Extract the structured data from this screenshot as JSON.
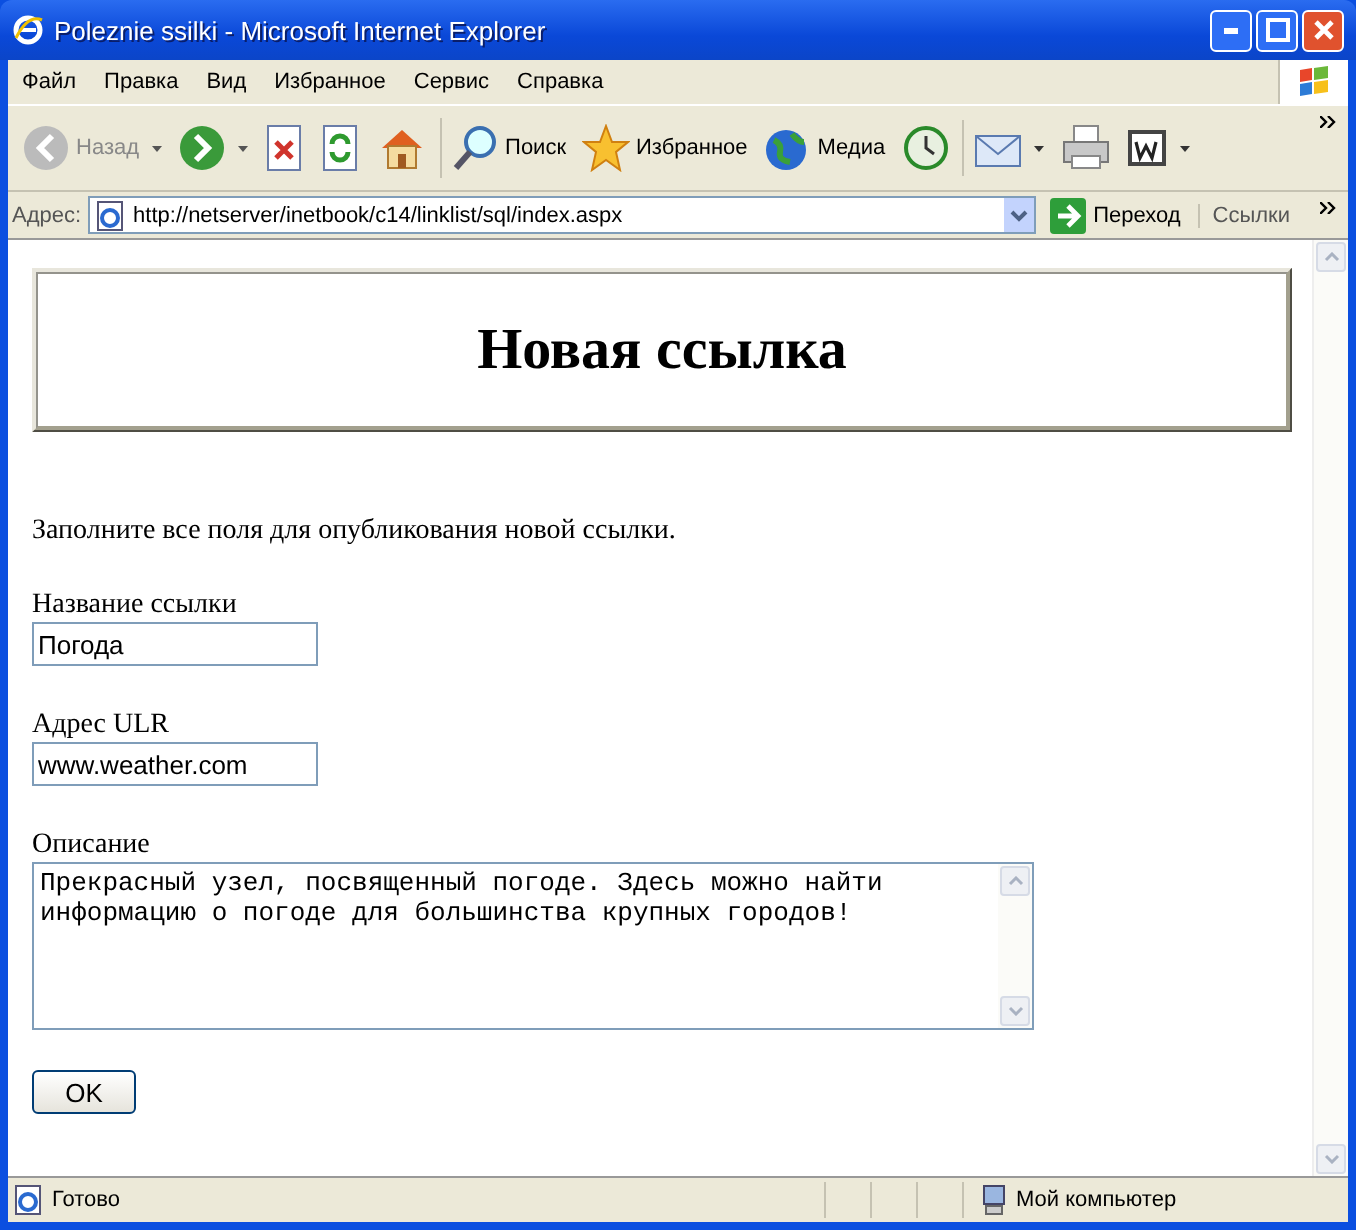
{
  "window": {
    "title": "Poleznie ssilki - Microsoft Internet Explorer"
  },
  "menu": [
    "Файл",
    "Правка",
    "Вид",
    "Избранное",
    "Сервис",
    "Справка"
  ],
  "toolbar": [
    {
      "kind": "back",
      "label": "Назад",
      "disabled": true
    },
    {
      "kind": "forward",
      "disabled": false
    },
    {
      "kind": "stop"
    },
    {
      "kind": "refresh"
    },
    {
      "kind": "home"
    },
    {
      "kind": "search",
      "label": "Поиск"
    },
    {
      "kind": "favorites",
      "label": "Избранное"
    },
    {
      "kind": "media",
      "label": "Медиа"
    },
    {
      "kind": "history"
    },
    {
      "kind": "mail"
    },
    {
      "kind": "print"
    },
    {
      "kind": "word"
    }
  ],
  "address_bar": {
    "label": "Адрес:",
    "url": "http://netserver/inetbook/c14/linklist/sql/index.aspx",
    "go": "Переход",
    "links": "Ссылки"
  },
  "page": {
    "heading": "Новая ссылка",
    "intro": "Заполните все поля для опубликования новой ссылки.",
    "fields": [
      {
        "label": "Название ссылки",
        "value": "Погода",
        "kind": "input"
      },
      {
        "label": "Адрес ULR",
        "value": "www.weather.com",
        "kind": "input"
      },
      {
        "label": "Описание",
        "value": "Прекрасный узел, посвященный погоде. Здесь можно найти информацию о погоде для большинства крупных городов!",
        "kind": "textarea"
      }
    ],
    "submit": "OK"
  },
  "status_bar": {
    "text": "Готово",
    "zone": "Мой компьютер"
  }
}
